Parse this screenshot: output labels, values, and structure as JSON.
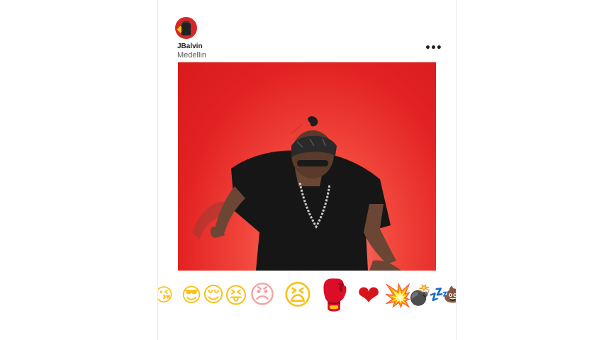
{
  "post": {
    "username": "JBalvin",
    "location": "Medellin",
    "more_label": "•••",
    "photo_alt": ""
  },
  "reactions": [
    {
      "name": "kiss-wink-emoji",
      "glyph": "😘",
      "color": "#f7c21b"
    },
    {
      "name": "sunglasses-emoji",
      "glyph": "😎",
      "color": "#f7c21b"
    },
    {
      "name": "relieved-emoji",
      "glyph": "😌",
      "color": "#f7c21b"
    },
    {
      "name": "tongue-wink-emoji",
      "glyph": "😝",
      "color": "#f7c21b"
    },
    {
      "name": "angry-emoji",
      "glyph": "😠",
      "color": "#f3a3a3"
    },
    {
      "name": "tired-emoji",
      "glyph": "😫",
      "color": "#f7c21b"
    },
    {
      "name": "boxing-glove-emoji",
      "glyph": "🥊",
      "color": "#d62828"
    },
    {
      "name": "heart-emoji",
      "glyph": "❤",
      "color": "#d9131b"
    },
    {
      "name": "collision-emoji",
      "glyph": "💥",
      "color": "#f07a18"
    },
    {
      "name": "bomb-emoji",
      "glyph": "💣",
      "color": "#2b2b3a"
    },
    {
      "name": "zzz-emoji",
      "glyph": "💤",
      "color": "#3a8fd8"
    },
    {
      "name": "poop-emoji",
      "glyph": "💩",
      "color": "#7a4a2a"
    }
  ]
}
